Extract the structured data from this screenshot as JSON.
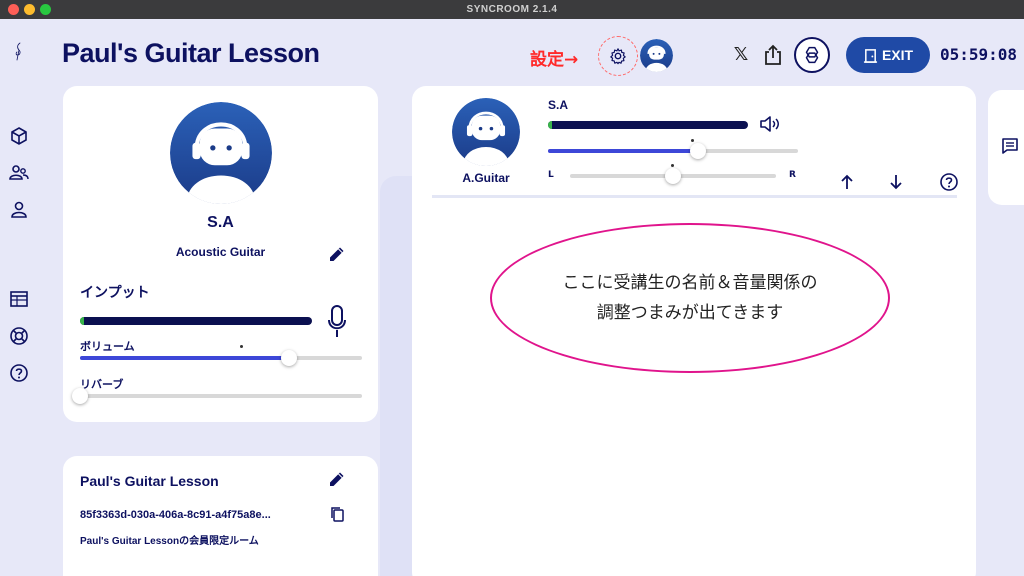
{
  "window": {
    "title": "SYNCROOM 2.1.4"
  },
  "header": {
    "room_title": "Paul's Guitar Lesson",
    "settings_annotation": "設定→",
    "exit_label": "EXIT",
    "timer": "05:59:08"
  },
  "sidebar": {
    "items": [
      "logo-icon",
      "room-icon",
      "members-icon",
      "profile-icon",
      "schedule-icon",
      "help-ring-icon",
      "question-icon"
    ]
  },
  "self_panel": {
    "name": "S.A",
    "instrument": "Acoustic Guitar",
    "input_heading": "インプット",
    "volume_label": "ボリューム",
    "volume_level": 0.74,
    "reverb_label": "リバーブ",
    "reverb_level": 0.0
  },
  "room_panel": {
    "name": "Paul's Guitar Lesson",
    "room_id": "85f3363d-030a-406a-8c91-a4f75a8e...",
    "description": "Paul's Guitar Lessonの会員限定ルーム"
  },
  "member": {
    "name": "S.A",
    "instrument": "A.Guitar",
    "volume_level": 0.6,
    "pan_left_label": "L",
    "pan_right_label": "R",
    "pan_level": 0.5
  },
  "callout": {
    "line1": "ここに受講生の名前＆音量関係の",
    "line2": "調整つまみが出てきます"
  },
  "colors": {
    "accent": "#3d47d8",
    "navy": "#0d1160",
    "exit_blue": "#1f4aa6",
    "annotation_red": "#ff2a2a",
    "callout_magenta": "#e0148c"
  }
}
